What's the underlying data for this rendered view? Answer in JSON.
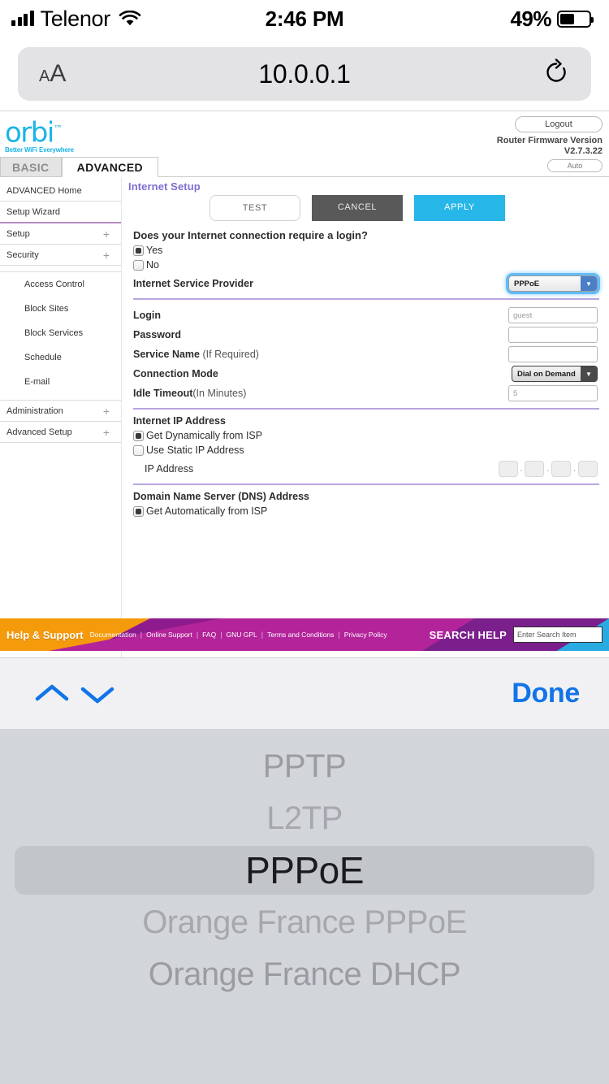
{
  "status_bar": {
    "carrier": "Telenor",
    "wifi_icon": "wifi-icon",
    "time": "2:46 PM",
    "battery_percent": "49%",
    "battery_level": 49
  },
  "browser": {
    "text_size_label": "A",
    "text_size_label_small": "A",
    "url": "10.0.0.1",
    "reload_icon": "reload-icon"
  },
  "router": {
    "brand": "orbi",
    "brand_tm": "™",
    "tagline": "Better WiFi Everywhere",
    "logout_label": "Logout",
    "firmware_label": "Router Firmware Version",
    "firmware_version": "V2.7.3.22",
    "language_value": "Auto",
    "tabs": [
      {
        "label": "BASIC",
        "active": false
      },
      {
        "label": "ADVANCED",
        "active": true
      }
    ],
    "sidebar": {
      "items": [
        {
          "label": "ADVANCED Home",
          "expandable": false
        },
        {
          "label": "Setup Wizard",
          "expandable": false
        },
        {
          "label": "Setup",
          "expandable": true,
          "plus": "+"
        },
        {
          "label": "Security",
          "expandable": true,
          "plus": "+"
        }
      ],
      "sub_items": [
        {
          "label": "Access Control"
        },
        {
          "label": "Block Sites"
        },
        {
          "label": "Block Services"
        },
        {
          "label": "Schedule"
        },
        {
          "label": "E-mail"
        }
      ],
      "items_bottom": [
        {
          "label": "Administration",
          "expandable": true,
          "plus": "+"
        },
        {
          "label": "Advanced Setup",
          "expandable": true,
          "plus": "+"
        }
      ]
    },
    "page": {
      "title": "Internet Setup",
      "buttons": {
        "test": "TEST",
        "cancel": "CANCEL",
        "apply": "APPLY"
      },
      "login_question": "Does your Internet connection require a login?",
      "login_options": [
        {
          "label": "Yes",
          "checked": true
        },
        {
          "label": "No",
          "checked": false
        }
      ],
      "isp_label": "Internet Service Provider",
      "isp_value": "PPPoE",
      "fields": [
        {
          "label": "Login",
          "value": "guest",
          "type": "text"
        },
        {
          "label": "Password",
          "value": "",
          "type": "text"
        },
        {
          "label": "Service Name",
          "label_soft": " (If Required)",
          "value": "",
          "type": "text"
        },
        {
          "label": "Connection Mode",
          "value": "Dial on Demand",
          "type": "select"
        },
        {
          "label": "Idle Timeout",
          "label_soft": "(In Minutes)",
          "value": "5",
          "type": "text"
        }
      ],
      "ip_section_title": "Internet IP Address",
      "ip_options": [
        {
          "label": "Get Dynamically from ISP",
          "checked": true
        },
        {
          "label": "Use Static IP Address",
          "checked": false
        }
      ],
      "ip_address_label": "IP Address",
      "ip_octets": [
        "",
        "",
        "",
        ""
      ],
      "dns_section_title": "Domain Name Server (DNS) Address",
      "dns_options": [
        {
          "label": "Get Automatically from ISP",
          "checked": true
        }
      ]
    },
    "footer": {
      "help_title": "Help & Support",
      "links": [
        "Documentation",
        "Online Support",
        "FAQ",
        "GNU GPL",
        "Terms and Conditions",
        "Privacy Policy"
      ],
      "separator": "|",
      "search_label": "SEARCH HELP",
      "search_placeholder": "Enter Search Item",
      "search_value": ""
    }
  },
  "keyboard_accessory": {
    "prev_icon": "chevron-up-icon",
    "next_icon": "chevron-down-icon",
    "done_label": "Done"
  },
  "picker": {
    "options": [
      {
        "label": "PPTP",
        "selected": false
      },
      {
        "label": "L2TP",
        "selected": false
      },
      {
        "label": "PPPoE",
        "selected": true
      },
      {
        "label": "Orange France PPPoE",
        "selected": false
      },
      {
        "label": "Orange France DHCP",
        "selected": false
      }
    ],
    "selected_value": "PPPoE"
  },
  "colors": {
    "accent_blue": "#26b6e8",
    "orbi_blue": "#19b4e8",
    "purple": "#7f6ed0",
    "divider_purple": "#b9a6e0",
    "footer_magenta": "#b3249a",
    "footer_orange": "#f59a0b",
    "ios_blue": "#1274e8"
  }
}
